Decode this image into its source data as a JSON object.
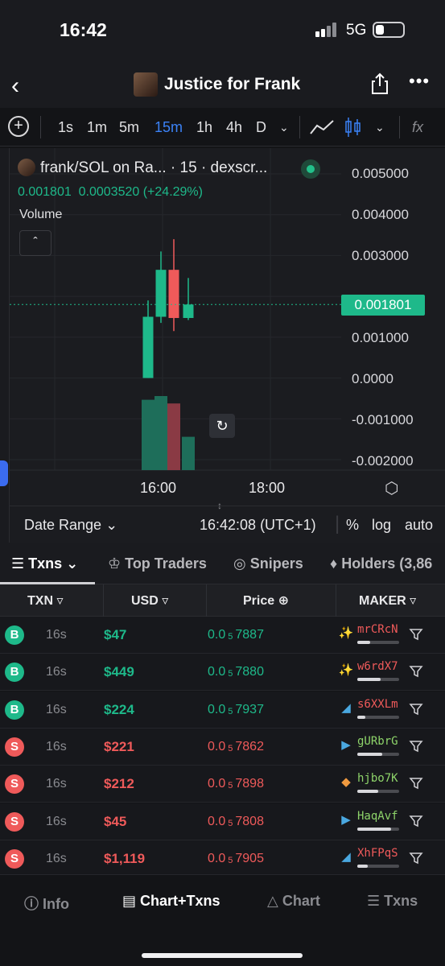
{
  "status": {
    "time": "16:42",
    "network": "5G"
  },
  "header": {
    "title": "Justice for Frank"
  },
  "toolbar": {
    "intervals": [
      "1s",
      "1m",
      "5m",
      "15m",
      "1h",
      "4h",
      "D"
    ],
    "active_interval": "15m"
  },
  "chart_legend": {
    "title": "frank/SOL on Ra... · 15 · dexscr...",
    "price": "0.001801",
    "change_abs": "0.0003520",
    "change_pct": "(+24.29%)",
    "volume_label": "Volume",
    "collapse_icon": "chevron-up-icon"
  },
  "current_price_tag": "0.001801",
  "chart_data": {
    "type": "candlestick",
    "x_ticks": [
      "16:00",
      "18:00"
    ],
    "y_ticks": [
      "0.005000",
      "0.004000",
      "0.003000",
      "0.001801",
      "0.001000",
      "0.0000",
      "-0.001000",
      "-0.002000"
    ],
    "ylim": [
      -0.002,
      0.005
    ],
    "candles": [
      {
        "open": -0.0,
        "high": 0.0019,
        "low": 0.0,
        "close": 0.0015,
        "volume": 0.95,
        "direction": "up"
      },
      {
        "open": 0.0015,
        "high": 0.0031,
        "low": 0.00135,
        "close": 0.00265,
        "volume": 1.0,
        "direction": "up"
      },
      {
        "open": 0.00265,
        "high": 0.0034,
        "low": 0.00115,
        "close": 0.00147,
        "volume": 0.9,
        "direction": "down"
      },
      {
        "open": 0.00147,
        "high": 0.00245,
        "low": 0.00142,
        "close": 0.0018,
        "volume": 0.45,
        "direction": "up"
      }
    ],
    "colors": {
      "up": "#1eb98a",
      "down": "#ef5a5a"
    }
  },
  "date_row": {
    "range": "Date Range ⌄",
    "clock": "16:42:08 (UTC+1)",
    "pct": "%",
    "log": "log",
    "auto": "auto"
  },
  "tabs": [
    "Txns",
    "Top Traders",
    "Snipers",
    "Holders (3,86"
  ],
  "table": {
    "headers": [
      "TXN",
      "USD",
      "Price",
      "MAKER"
    ],
    "rows": [
      {
        "type": "B",
        "age": "16s",
        "usd": "$47",
        "price_prefix": "0.0",
        "price_sub": "5",
        "price_rest": "7887",
        "maker": "mrCRcN",
        "maker_icon": "sparkle-icon",
        "maker_color": "#ef5a5a"
      },
      {
        "type": "B",
        "age": "16s",
        "usd": "$449",
        "price_prefix": "0.0",
        "price_sub": "5",
        "price_rest": "7880",
        "maker": "w6rdX7",
        "maker_icon": "sparkle-icon",
        "maker_color": "#ef5a5a"
      },
      {
        "type": "B",
        "age": "16s",
        "usd": "$224",
        "price_prefix": "0.0",
        "price_sub": "5",
        "price_rest": "7937",
        "maker": "s6XXLm",
        "maker_icon": "dolphin-icon",
        "maker_color": "#ef5a5a"
      },
      {
        "type": "S",
        "age": "16s",
        "usd": "$221",
        "price_prefix": "0.0",
        "price_sub": "5",
        "price_rest": "7862",
        "maker": "gURbrG",
        "maker_icon": "shrimp-icon",
        "maker_color": "#8ed46a"
      },
      {
        "type": "S",
        "age": "16s",
        "usd": "$212",
        "price_prefix": "0.0",
        "price_sub": "5",
        "price_rest": "7898",
        "maker": "hjbo7K",
        "maker_icon": "fish-icon",
        "maker_color": "#8ed46a"
      },
      {
        "type": "S",
        "age": "16s",
        "usd": "$45",
        "price_prefix": "0.0",
        "price_sub": "5",
        "price_rest": "7808",
        "maker": "HaqAvf",
        "maker_icon": "shrimp-icon",
        "maker_color": "#8ed46a"
      },
      {
        "type": "S",
        "age": "16s",
        "usd": "$1,119",
        "price_prefix": "0.0",
        "price_sub": "5",
        "price_rest": "7905",
        "maker": "XhFPqS",
        "maker_icon": "dolphin-icon",
        "maker_color": "#ef5a5a"
      }
    ]
  },
  "bottom_nav": [
    "Info",
    "Chart+Txns",
    "Chart",
    "Txns"
  ]
}
